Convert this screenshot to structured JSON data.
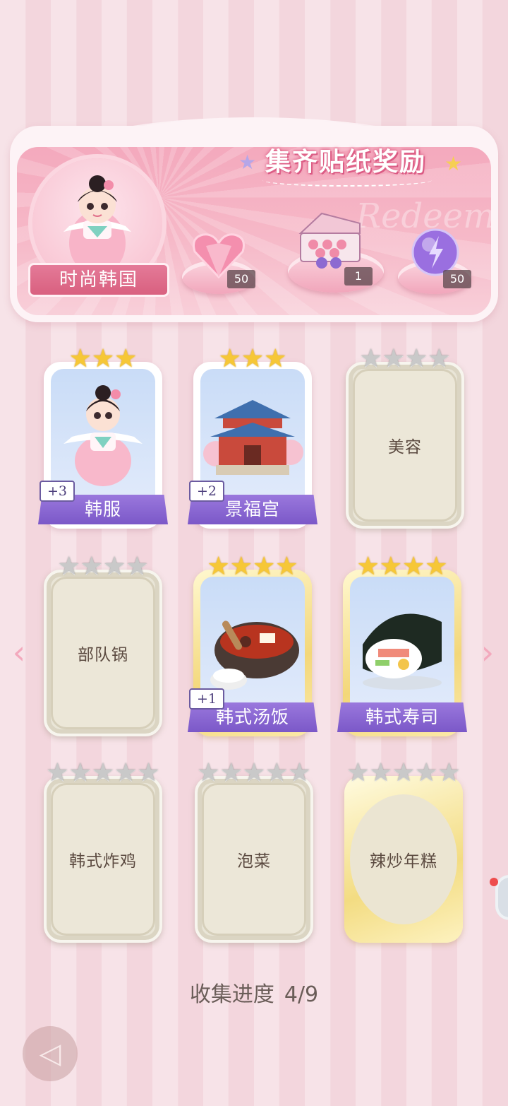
{
  "reward": {
    "title": "集齐贴纸奖励",
    "watermark": "Redeem",
    "theme_label": "时尚韩国",
    "items": [
      {
        "icon": "pink-heart-gem-icon",
        "count": "50"
      },
      {
        "icon": "gift-box-icon",
        "count": "1"
      },
      {
        "icon": "purple-lightning-orb-icon",
        "count": "50"
      }
    ]
  },
  "stickers": [
    {
      "name": "韩服",
      "stars": 3,
      "max_stars": 3,
      "owned": true,
      "plus": "+3",
      "art": "hanbok-girl-art"
    },
    {
      "name": "景福宫",
      "stars": 3,
      "max_stars": 3,
      "owned": true,
      "plus": "+2",
      "art": "gyeongbokgung-palace-art"
    },
    {
      "name": "美容",
      "stars": 0,
      "max_stars": 4,
      "owned": false
    },
    {
      "name": "部队锅",
      "stars": 0,
      "max_stars": 4,
      "owned": false
    },
    {
      "name": "韩式汤饭",
      "stars": 4,
      "max_stars": 4,
      "owned": true,
      "plus": "+1",
      "art": "korean-soup-rice-art"
    },
    {
      "name": "韩式寿司",
      "stars": 4,
      "max_stars": 4,
      "owned": true,
      "art": "kimbap-art"
    },
    {
      "name": "韩式炸鸡",
      "stars": 0,
      "max_stars": 5,
      "owned": false
    },
    {
      "name": "泡菜",
      "stars": 0,
      "max_stars": 5,
      "owned": false
    },
    {
      "name": "辣炒年糕",
      "stars": 0,
      "max_stars": 5,
      "owned": false
    }
  ],
  "progress": {
    "label": "收集进度",
    "value": "4/9",
    "collected": 4,
    "total": 9
  },
  "colors": {
    "ribbon_purple": "#8a68d3",
    "star_gold": "#f6c737",
    "star_grey": "#c9c9c9",
    "panel_pink": "#f4a9bd"
  }
}
